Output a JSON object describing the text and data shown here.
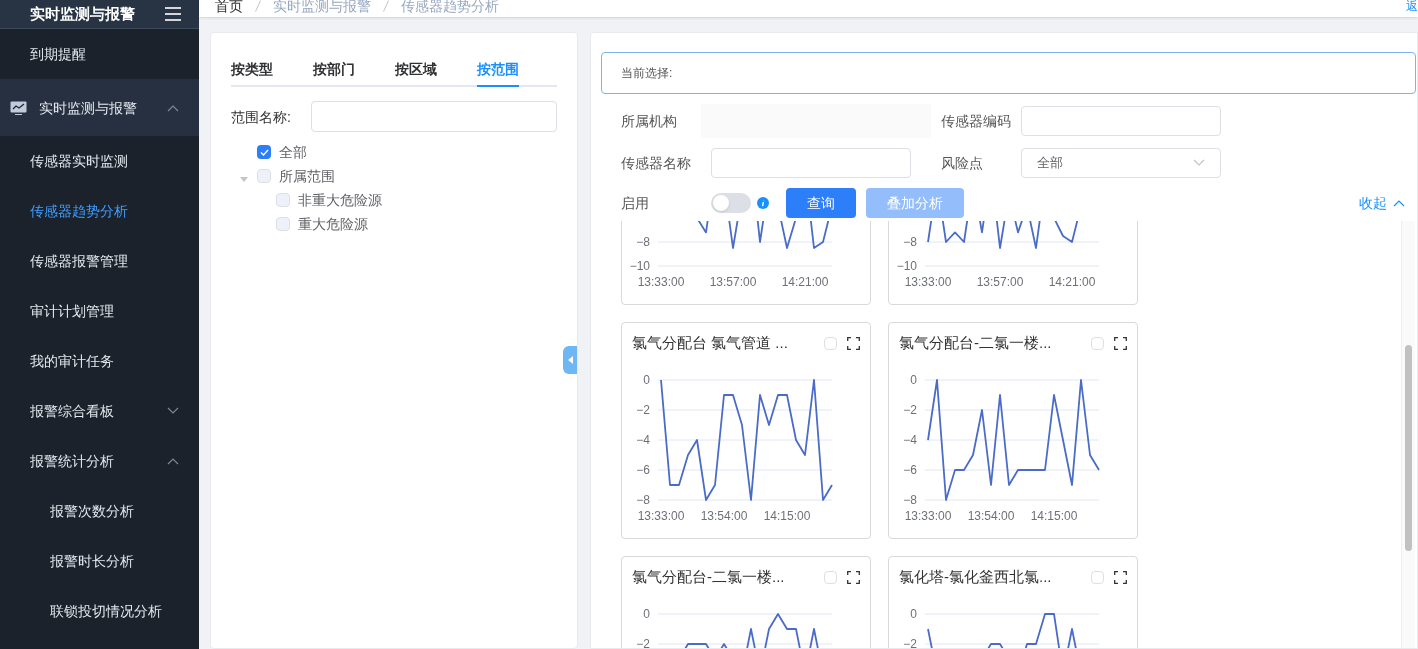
{
  "sidebar": {
    "title": "实时监测与报警",
    "items": [
      {
        "label": "到期提醒",
        "selected": false
      },
      {
        "label": "实时监测与报警",
        "selected": false,
        "expanded": true,
        "children": [
          {
            "label": "传感器实时监测",
            "selected": false
          },
          {
            "label": "传感器趋势分析",
            "selected": true
          },
          {
            "label": "传感器报警管理",
            "selected": false
          },
          {
            "label": "审计计划管理",
            "selected": false
          },
          {
            "label": "我的审计任务",
            "selected": false
          },
          {
            "label": "报警综合看板",
            "selected": false,
            "expanded": false
          },
          {
            "label": "报警统计分析",
            "selected": false,
            "expanded": true,
            "children": [
              {
                "label": "报警次数分析",
                "selected": false
              },
              {
                "label": "报警时长分析",
                "selected": false
              },
              {
                "label": "联锁投切情况分析",
                "selected": false
              }
            ]
          }
        ]
      }
    ]
  },
  "breadcrumb": [
    "首页",
    "实时监测与报警",
    "传感器趋势分析"
  ],
  "back_link": "返",
  "left_panel": {
    "tabs": [
      {
        "label": "按类型",
        "selected": false
      },
      {
        "label": "按部门",
        "selected": false
      },
      {
        "label": "按区域",
        "selected": false
      },
      {
        "label": "按范围",
        "selected": true
      }
    ],
    "search_label": "范围名称:",
    "tree": [
      {
        "label": "全部",
        "checked": true
      },
      {
        "label": "所属范围",
        "checked": false,
        "expanded": true,
        "children": [
          {
            "label": "非重大危险源",
            "checked": false
          },
          {
            "label": "重大危险源",
            "checked": false
          }
        ]
      }
    ]
  },
  "filters": {
    "current_selection": "当前选择:",
    "fields": [
      {
        "label": "所属机构",
        "kind": "blank"
      },
      {
        "label": "传感器编码",
        "kind": "input"
      },
      {
        "label": "传感器名称",
        "kind": "input"
      },
      {
        "label": "风险点",
        "kind": "select",
        "value": "全部"
      }
    ],
    "enable_label": "启用",
    "enable_on": false,
    "buttons": [
      {
        "label": "查询",
        "disabled": false
      },
      {
        "label": "叠加分析",
        "disabled": true
      }
    ],
    "collapse_link": "收起"
  },
  "charts": [
    {
      "kind": "cut_top",
      "y_labels": [
        "−8",
        "−10"
      ],
      "x_labels": [
        "13:33:00",
        "13:57:00",
        "14:21:00"
      ]
    },
    {
      "kind": "cut_top",
      "y_labels": [
        "−8",
        "−10"
      ],
      "x_labels": [
        "13:33:00",
        "13:57:00",
        "14:21:00"
      ]
    },
    {
      "kind": "full",
      "title": "氯气分配台 氯气管道 ...",
      "checked": false,
      "x_labels": [
        "13:33:00",
        "13:54:00",
        "14:15:00"
      ],
      "chart_data": {
        "type": "line",
        "grid": true,
        "ylim": [
          -8,
          0
        ],
        "yticks": [
          0,
          -2,
          -4,
          -6,
          -8
        ],
        "series": [
          {
            "color": "#4a6bc8",
            "values": [
              0,
              -7,
              -7,
              -5,
              -4,
              -8,
              -7,
              -1,
              -1,
              -3,
              -8,
              -1,
              -3,
              -1,
              -1,
              -4,
              -5,
              0,
              -8,
              -7
            ]
          }
        ]
      }
    },
    {
      "kind": "full",
      "title": "氯气分配台-二氯一楼...",
      "checked": false,
      "x_labels": [
        "13:33:00",
        "13:54:00",
        "14:15:00"
      ],
      "chart_data": {
        "type": "line",
        "grid": true,
        "ylim": [
          -8,
          0
        ],
        "yticks": [
          0,
          -2,
          -4,
          -6,
          -8
        ],
        "series": [
          {
            "color": "#4a6bc8",
            "values": [
              -4,
              0,
              -8,
              -6,
              -6,
              -5,
              -2,
              -7,
              -1,
              -7,
              -6,
              -6,
              -6,
              -6,
              -1,
              -4,
              -7,
              0,
              -5,
              -6
            ]
          }
        ]
      }
    },
    {
      "kind": "cut_bottom",
      "title": "氯气分配台-二氯一楼...",
      "checked": false,
      "y_labels": [
        "0",
        "−2"
      ]
    },
    {
      "kind": "cut_bottom",
      "title": "氯化塔-氯化釜西北氯...",
      "checked": false,
      "y_labels": [
        "0",
        "−2"
      ]
    }
  ]
}
